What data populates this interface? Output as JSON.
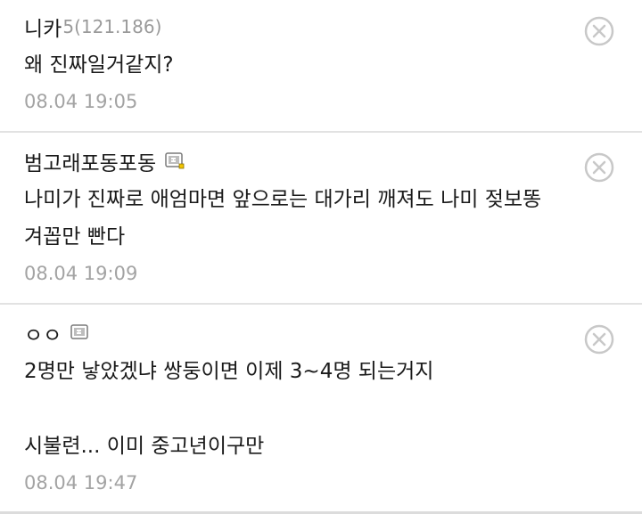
{
  "comments": [
    {
      "author": "니카",
      "level": "5",
      "ip": "(121.186)",
      "has_badge": false,
      "body": "왜 진짜일거같지?",
      "time": "08.04 19:05"
    },
    {
      "author": "범고래포동포동",
      "level": "",
      "ip": "",
      "has_badge": true,
      "body": "나미가 진짜로 애엄마면 앞으로는 대가리 깨져도 나미 젖보똥\n겨꼽만 빤다",
      "time": "08.04 19:09"
    },
    {
      "author": "ㅇㅇ",
      "level": "",
      "ip": "",
      "has_badge": true,
      "body": "2명만 낳았겠냐 쌍둥이면 이제 3~4명 되는거지\n\n시불련... 이미 중고년이구만",
      "time": "08.04 19:47"
    }
  ],
  "icons": {
    "delete": "close-circle-icon",
    "badge": "fixed-nick-badge-icon"
  },
  "colors": {
    "text": "#1a1a1a",
    "meta": "#9a9a9a",
    "divider": "#e2e2e2",
    "icon": "#c8c8c8"
  }
}
